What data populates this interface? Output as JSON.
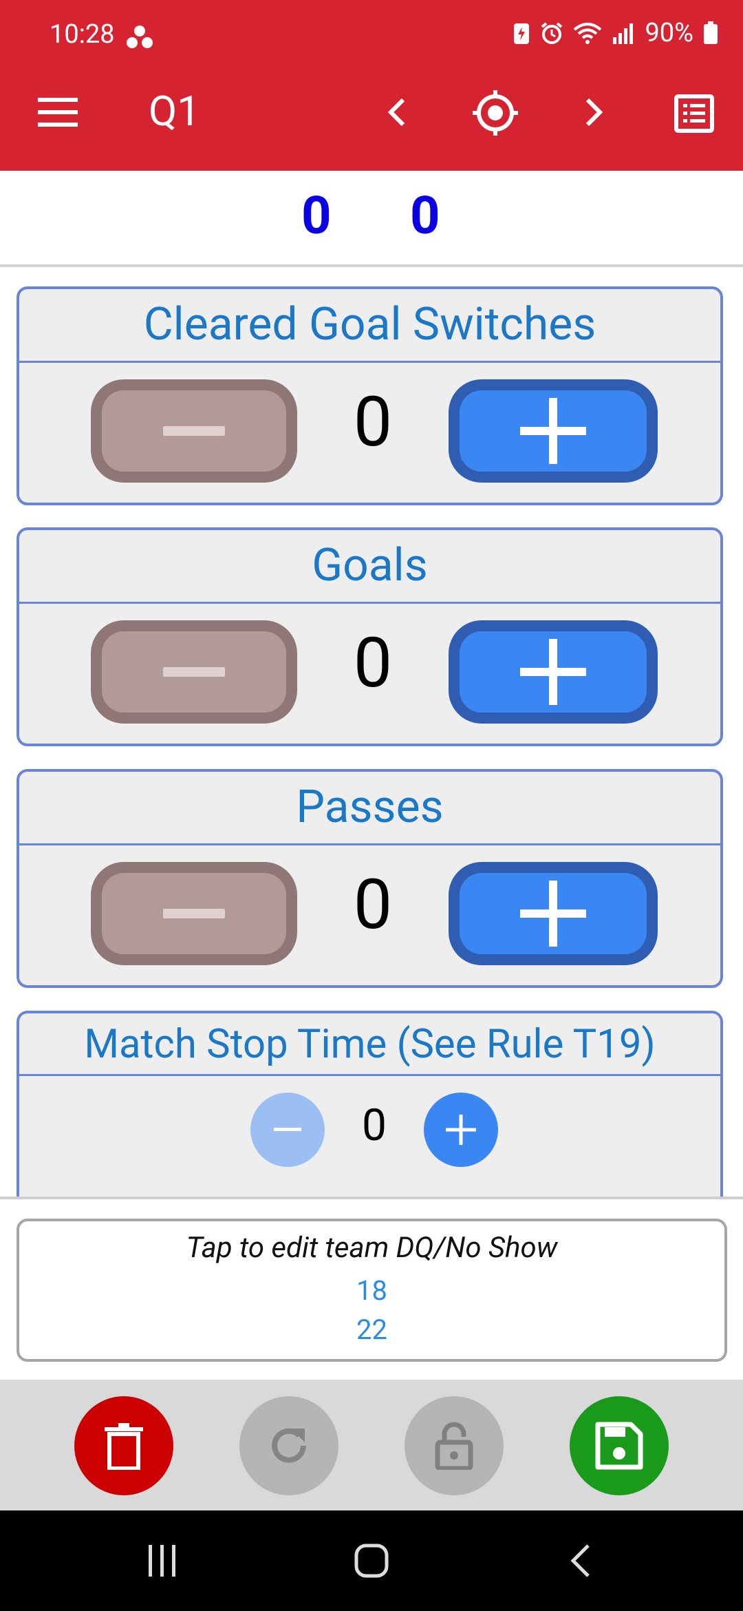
{
  "status_bar": {
    "time": "10:28",
    "battery": "90%"
  },
  "app_bar": {
    "title": "Q1",
    "icons": [
      "menu-icon",
      "chevron-left-icon",
      "crosshair-icon",
      "chevron-right-icon",
      "list-icon"
    ]
  },
  "scores": {
    "left": "0",
    "right": "0"
  },
  "cards": [
    {
      "title": "Cleared Goal Switches",
      "value": "0"
    },
    {
      "title": "Goals",
      "value": "0"
    },
    {
      "title": "Passes",
      "value": "0"
    },
    {
      "title": "Match Stop Time (See Rule T19)",
      "value": "0"
    }
  ],
  "dq": {
    "title": "Tap to edit team DQ/No Show",
    "teams": [
      "18",
      "22"
    ]
  },
  "toolbar": {
    "icons": [
      "trash-icon",
      "refresh-icon",
      "lock-open-icon",
      "save-icon"
    ]
  },
  "colors": {
    "header": "#d52331",
    "score": "#0b00e3",
    "card_title": "#1b78c6",
    "plus": "#3a86f2",
    "delete": "#cc0000",
    "save": "#1a9a1a"
  }
}
